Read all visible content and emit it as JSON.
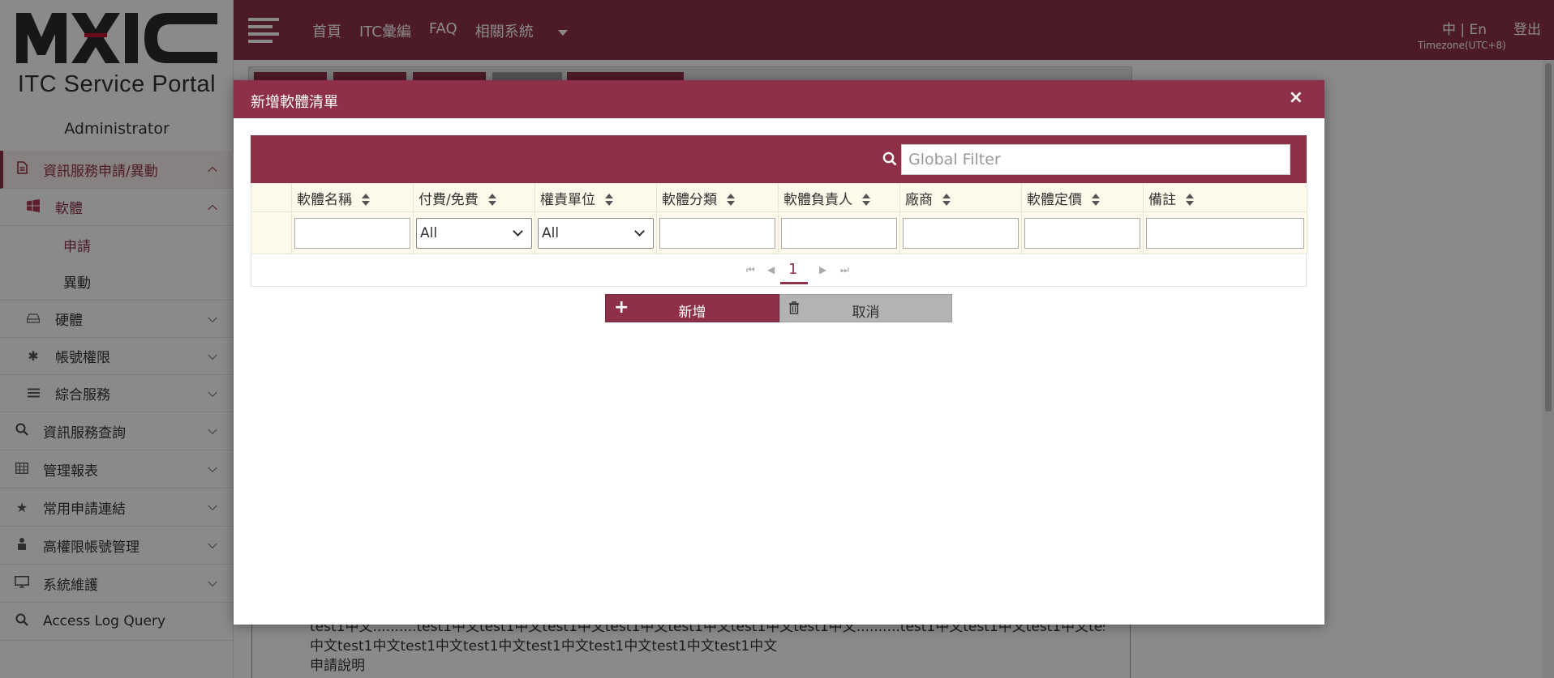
{
  "brand": {
    "logo_text": "MXIC",
    "portal_title": "ITC Service Portal",
    "user": "Administrator"
  },
  "topbar": {
    "menu": [
      "首頁",
      "ITC彙編",
      "FAQ",
      "相關系統"
    ],
    "lang": "中 | En",
    "logout": "登出",
    "timezone": "Timezone(UTC+8)"
  },
  "sidebar": {
    "items": [
      {
        "label": "資訊服務申請/異動",
        "icon": "file-icon"
      },
      {
        "label": "軟體",
        "icon": "windows-icon"
      },
      {
        "label": "申請"
      },
      {
        "label": "異動"
      },
      {
        "label": "硬體",
        "icon": "harddrive-icon"
      },
      {
        "label": "帳號權限",
        "icon": "asterisk-icon"
      },
      {
        "label": "綜合服務",
        "icon": "list-icon"
      },
      {
        "label": "資訊服務查詢",
        "icon": "search-icon"
      },
      {
        "label": "管理報表",
        "icon": "table-icon"
      },
      {
        "label": "常用申請連結",
        "icon": "star-icon"
      },
      {
        "label": "高權限帳號管理",
        "icon": "user-lock-icon"
      },
      {
        "label": "系統維護",
        "icon": "monitor-icon"
      },
      {
        "label": "Access Log Query",
        "icon": "search-icon"
      }
    ]
  },
  "background": {
    "text_lines": [
      "test1中文..........test1中文test1中文test1中文test1中文test1中文test1中文test1中文..........test1中文test1中文test1中文test1",
      "中文test1中文test1中文test1中文test1中文test1中文test1中文test1中文",
      "申請說明"
    ]
  },
  "modal": {
    "title": "新增軟體清單",
    "close": "×",
    "filter_placeholder": "Global Filter",
    "columns": [
      "軟體名稱",
      "付費/免費",
      "權責單位",
      "軟體分類",
      "軟體負責人",
      "廠商",
      "軟體定價",
      "備註"
    ],
    "select_default": "All",
    "page": "1",
    "add_label": "新增",
    "cancel_label": "取消"
  },
  "colors": {
    "primary": "#8e3048",
    "header_bg": "#fdfaec",
    "cancel_bg": "#b3b3b3"
  }
}
